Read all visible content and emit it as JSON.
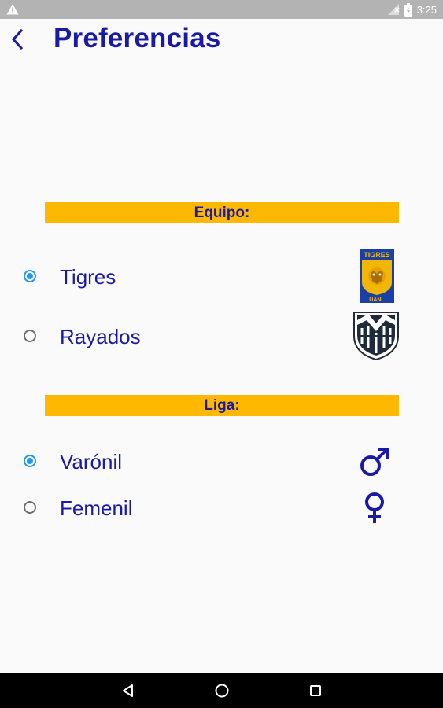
{
  "status_bar": {
    "time": "3:25",
    "icons": [
      "warning-icon",
      "no-signal-icon",
      "battery-icon"
    ]
  },
  "header": {
    "title": "Preferencias",
    "back_icon": "chevron-left-icon"
  },
  "equipo": {
    "heading": "Equipo:",
    "options": [
      {
        "label": "Tigres",
        "selected": true,
        "icon": "tigres-logo-icon"
      },
      {
        "label": "Rayados",
        "selected": false,
        "icon": "rayados-logo-icon"
      }
    ]
  },
  "liga": {
    "heading": "Liga:",
    "options": [
      {
        "label": "Varónil",
        "selected": true,
        "icon": "male-symbol-icon"
      },
      {
        "label": "Femenil",
        "selected": false,
        "icon": "female-symbol-icon"
      }
    ]
  },
  "logos": {
    "tigres_top": "TIGRES",
    "tigres_bottom": "UANL"
  },
  "colors": {
    "accent": "#1a1aa6",
    "section_bar": "#ffb800",
    "radio_selected": "#2196f3",
    "status_bar": "#b3b3b3",
    "nav_bar": "#000000"
  },
  "nav": {
    "icons": [
      "back-triangle-icon",
      "home-circle-icon",
      "recents-square-icon"
    ]
  }
}
